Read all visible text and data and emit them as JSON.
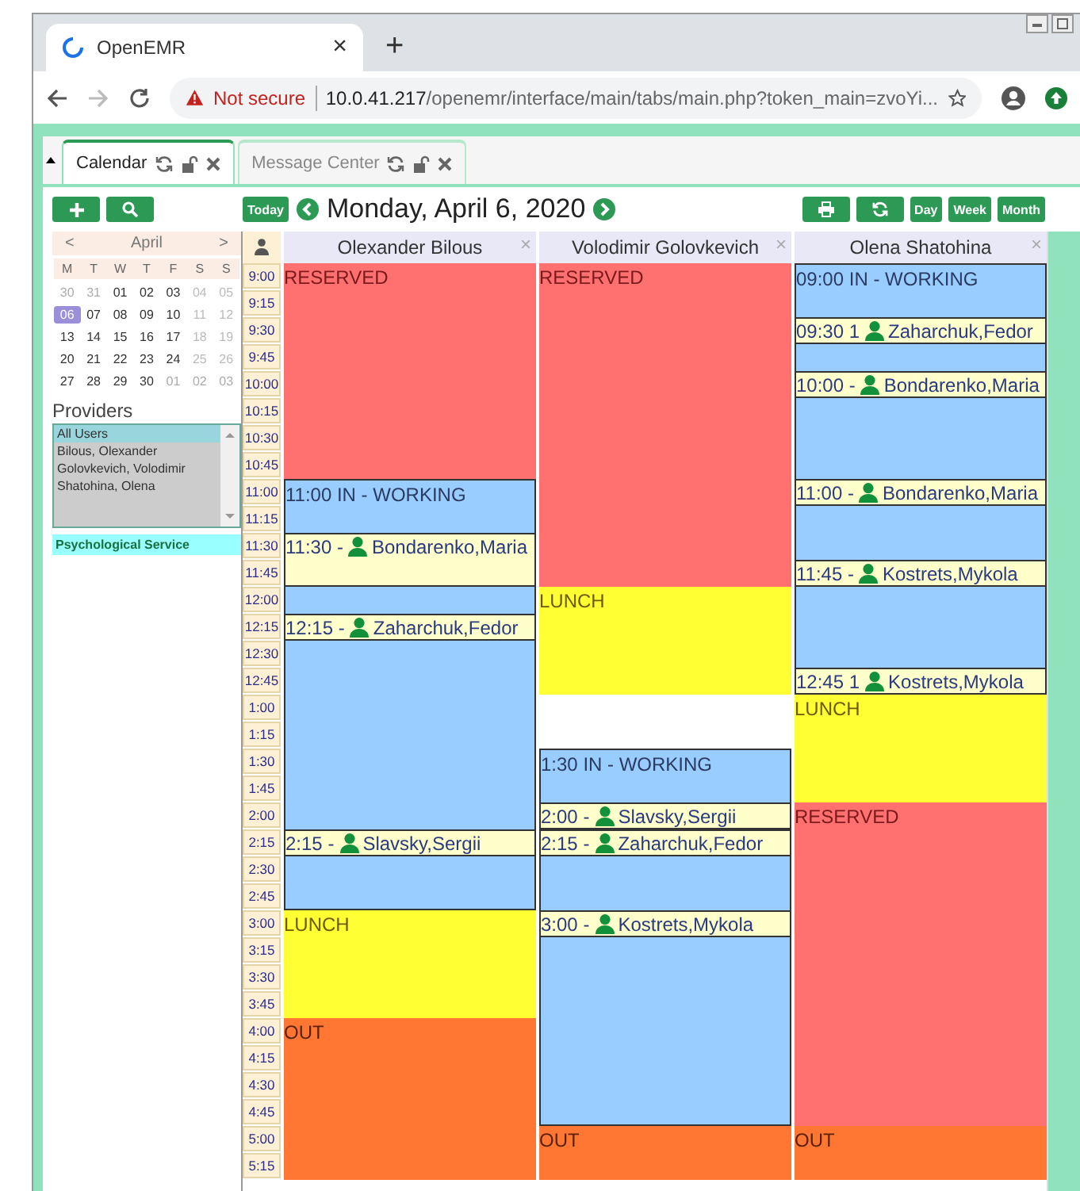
{
  "browser": {
    "tab_title": "OpenEMR",
    "tab_close": "×",
    "new_tab": "+",
    "security": "Not secure",
    "url_host": "10.0.41.217",
    "url_path": "/openemr/interface/main/tabs/main.php?token_main=zvoYi..."
  },
  "app_tabs": [
    {
      "label": "Calendar",
      "selected": true
    },
    {
      "label": "Message Center",
      "selected": false
    }
  ],
  "toolbar": {
    "today": "Today",
    "date_title": "Monday, April 6, 2020",
    "views": [
      "Day",
      "Week",
      "Month"
    ]
  },
  "mini_calendar": {
    "prev": "<",
    "month": "April",
    "next": ">",
    "weekdays": [
      "M",
      "T",
      "W",
      "T",
      "F",
      "S",
      "S"
    ],
    "weeks": [
      [
        {
          "d": "30",
          "kind": "other",
          "selected": false
        },
        {
          "d": "31",
          "kind": "other",
          "selected": false
        },
        {
          "d": "01",
          "kind": "day",
          "selected": false
        },
        {
          "d": "02",
          "kind": "day",
          "selected": false
        },
        {
          "d": "03",
          "kind": "day",
          "selected": false
        },
        {
          "d": "04",
          "kind": "weekend",
          "selected": false
        },
        {
          "d": "05",
          "kind": "weekend",
          "selected": false
        }
      ],
      [
        {
          "d": "06",
          "kind": "day",
          "selected": true
        },
        {
          "d": "07",
          "kind": "day",
          "selected": false
        },
        {
          "d": "08",
          "kind": "day",
          "selected": false
        },
        {
          "d": "09",
          "kind": "day",
          "selected": false
        },
        {
          "d": "10",
          "kind": "day",
          "selected": false
        },
        {
          "d": "11",
          "kind": "weekend",
          "selected": false
        },
        {
          "d": "12",
          "kind": "weekend",
          "selected": false
        }
      ],
      [
        {
          "d": "13",
          "kind": "day",
          "selected": false
        },
        {
          "d": "14",
          "kind": "day",
          "selected": false
        },
        {
          "d": "15",
          "kind": "day",
          "selected": false
        },
        {
          "d": "16",
          "kind": "day",
          "selected": false
        },
        {
          "d": "17",
          "kind": "day",
          "selected": false
        },
        {
          "d": "18",
          "kind": "weekend",
          "selected": false
        },
        {
          "d": "19",
          "kind": "weekend",
          "selected": false
        }
      ],
      [
        {
          "d": "20",
          "kind": "day",
          "selected": false
        },
        {
          "d": "21",
          "kind": "day",
          "selected": false
        },
        {
          "d": "22",
          "kind": "day",
          "selected": false
        },
        {
          "d": "23",
          "kind": "day",
          "selected": false
        },
        {
          "d": "24",
          "kind": "day",
          "selected": false
        },
        {
          "d": "25",
          "kind": "weekend",
          "selected": false
        },
        {
          "d": "26",
          "kind": "weekend",
          "selected": false
        }
      ],
      [
        {
          "d": "27",
          "kind": "day",
          "selected": false
        },
        {
          "d": "28",
          "kind": "day",
          "selected": false
        },
        {
          "d": "29",
          "kind": "day",
          "selected": false
        },
        {
          "d": "30",
          "kind": "day",
          "selected": false
        },
        {
          "d": "01",
          "kind": "other",
          "selected": false
        },
        {
          "d": "02",
          "kind": "other",
          "selected": false
        },
        {
          "d": "03",
          "kind": "other",
          "selected": false
        }
      ]
    ]
  },
  "providers": {
    "title": "Providers",
    "items": [
      {
        "label": "All Users",
        "selected": true
      },
      {
        "label": "Bilous, Olexander",
        "selected": false
      },
      {
        "label": "Golovkevich, Volodimir",
        "selected": false
      },
      {
        "label": "Shatohina, Olena",
        "selected": false
      }
    ]
  },
  "facility": "Psychological Service",
  "columns": [
    {
      "name": "Olexander Bilous",
      "close": "×"
    },
    {
      "name": "Volodimir Golovkevich",
      "close": "×"
    },
    {
      "name": "Olena Shatohina",
      "close": "×"
    }
  ],
  "slots": [
    {
      "time": "9:00",
      "cells": [
        {
          "kind": "reserved",
          "label": "RESERVED"
        },
        {
          "kind": "reserved",
          "label": "RESERVED"
        },
        {
          "kind": "working",
          "label": "09:00 IN - WORKING"
        }
      ]
    },
    {
      "time": "9:15",
      "cells": [
        {
          "kind": "reserved"
        },
        {
          "kind": "reserved"
        },
        {
          "kind": "working"
        }
      ]
    },
    {
      "time": "9:30",
      "cells": [
        {
          "kind": "reserved"
        },
        {
          "kind": "reserved"
        },
        {
          "kind": "appointment",
          "time": "09:30 1",
          "patient": "Zaharchuk,Fedor"
        }
      ]
    },
    {
      "time": "9:45",
      "cells": [
        {
          "kind": "reserved"
        },
        {
          "kind": "reserved"
        },
        {
          "kind": "working"
        }
      ]
    },
    {
      "time": "10:00",
      "cells": [
        {
          "kind": "reserved"
        },
        {
          "kind": "reserved"
        },
        {
          "kind": "appointment",
          "time": "10:00 -",
          "patient": "Bondarenko,Maria"
        }
      ]
    },
    {
      "time": "10:15",
      "cells": [
        {
          "kind": "reserved"
        },
        {
          "kind": "reserved"
        },
        {
          "kind": "working"
        }
      ]
    },
    {
      "time": "10:30",
      "cells": [
        {
          "kind": "reserved"
        },
        {
          "kind": "reserved"
        },
        {
          "kind": "working"
        }
      ]
    },
    {
      "time": "10:45",
      "cells": [
        {
          "kind": "reserved"
        },
        {
          "kind": "reserved"
        },
        {
          "kind": "working"
        }
      ]
    },
    {
      "time": "11:00",
      "cells": [
        {
          "kind": "working",
          "label": "11:00 IN - WORKING"
        },
        {
          "kind": "reserved"
        },
        {
          "kind": "appointment",
          "time": "11:00 -",
          "patient": "Bondarenko,Maria"
        }
      ]
    },
    {
      "time": "11:15",
      "cells": [
        {
          "kind": "working"
        },
        {
          "kind": "reserved"
        },
        {
          "kind": "working"
        }
      ]
    },
    {
      "time": "11:30",
      "cells": [
        {
          "kind": "appointment",
          "time": "11:30 -",
          "patient": "Bondarenko,Maria"
        },
        {
          "kind": "reserved"
        },
        {
          "kind": "working"
        }
      ]
    },
    {
      "time": "11:45",
      "cells": [
        {
          "kind": "appointment"
        },
        {
          "kind": "reserved"
        },
        {
          "kind": "appointment",
          "time": "11:45 -",
          "patient": "Kostrets,Mykola"
        }
      ]
    },
    {
      "time": "12:00",
      "cells": [
        {
          "kind": "working"
        },
        {
          "kind": "lunch",
          "label": "LUNCH"
        },
        {
          "kind": "working"
        }
      ]
    },
    {
      "time": "12:15",
      "cells": [
        {
          "kind": "appointment",
          "time": "12:15 -",
          "patient": "Zaharchuk,Fedor"
        },
        {
          "kind": "lunch"
        },
        {
          "kind": "working"
        }
      ]
    },
    {
      "time": "12:30",
      "cells": [
        {
          "kind": "working"
        },
        {
          "kind": "lunch"
        },
        {
          "kind": "working"
        }
      ]
    },
    {
      "time": "12:45",
      "cells": [
        {
          "kind": "working"
        },
        {
          "kind": "lunch"
        },
        {
          "kind": "appointment",
          "time": "12:45 1",
          "patient": "Kostrets,Mykola"
        }
      ]
    },
    {
      "time": "1:00",
      "cells": [
        {
          "kind": "working"
        },
        {
          "kind": "empty"
        },
        {
          "kind": "lunch",
          "label": "LUNCH"
        }
      ]
    },
    {
      "time": "1:15",
      "cells": [
        {
          "kind": "working"
        },
        {
          "kind": "empty"
        },
        {
          "kind": "lunch"
        }
      ]
    },
    {
      "time": "1:30",
      "cells": [
        {
          "kind": "working"
        },
        {
          "kind": "working",
          "label": "1:30 IN - WORKING"
        },
        {
          "kind": "lunch"
        }
      ]
    },
    {
      "time": "1:45",
      "cells": [
        {
          "kind": "working"
        },
        {
          "kind": "working"
        },
        {
          "kind": "lunch"
        }
      ]
    },
    {
      "time": "2:00",
      "cells": [
        {
          "kind": "working"
        },
        {
          "kind": "appointment",
          "time": "2:00 -",
          "patient": "Slavsky,Sergii"
        },
        {
          "kind": "reserved",
          "label": "RESERVED"
        }
      ]
    },
    {
      "time": "2:15",
      "cells": [
        {
          "kind": "appointment",
          "time": "2:15 -",
          "patient": "Slavsky,Sergii"
        },
        {
          "kind": "appointment",
          "time": "2:15 -",
          "patient": "Zaharchuk,Fedor"
        },
        {
          "kind": "reserved"
        }
      ]
    },
    {
      "time": "2:30",
      "cells": [
        {
          "kind": "working"
        },
        {
          "kind": "working"
        },
        {
          "kind": "reserved"
        }
      ]
    },
    {
      "time": "2:45",
      "cells": [
        {
          "kind": "working"
        },
        {
          "kind": "working"
        },
        {
          "kind": "reserved"
        }
      ]
    },
    {
      "time": "3:00",
      "cells": [
        {
          "kind": "lunch",
          "label": "LUNCH"
        },
        {
          "kind": "appointment",
          "time": "3:00 -",
          "patient": "Kostrets,Mykola"
        },
        {
          "kind": "reserved"
        }
      ]
    },
    {
      "time": "3:15",
      "cells": [
        {
          "kind": "lunch"
        },
        {
          "kind": "working"
        },
        {
          "kind": "reserved"
        }
      ]
    },
    {
      "time": "3:30",
      "cells": [
        {
          "kind": "lunch"
        },
        {
          "kind": "working"
        },
        {
          "kind": "reserved"
        }
      ]
    },
    {
      "time": "3:45",
      "cells": [
        {
          "kind": "lunch"
        },
        {
          "kind": "working"
        },
        {
          "kind": "reserved"
        }
      ]
    },
    {
      "time": "4:00",
      "cells": [
        {
          "kind": "out",
          "label": "OUT"
        },
        {
          "kind": "working"
        },
        {
          "kind": "reserved"
        }
      ]
    },
    {
      "time": "4:15",
      "cells": [
        {
          "kind": "out"
        },
        {
          "kind": "working"
        },
        {
          "kind": "reserved"
        }
      ]
    },
    {
      "time": "4:30",
      "cells": [
        {
          "kind": "out"
        },
        {
          "kind": "working"
        },
        {
          "kind": "reserved"
        }
      ]
    },
    {
      "time": "4:45",
      "cells": [
        {
          "kind": "out"
        },
        {
          "kind": "working"
        },
        {
          "kind": "reserved"
        }
      ]
    },
    {
      "time": "5:00",
      "cells": [
        {
          "kind": "out"
        },
        {
          "kind": "out",
          "label": "OUT"
        },
        {
          "kind": "out",
          "label": "OUT"
        }
      ]
    },
    {
      "time": "5:15",
      "cells": [
        {
          "kind": "out"
        },
        {
          "kind": "out"
        },
        {
          "kind": "out"
        }
      ]
    }
  ]
}
